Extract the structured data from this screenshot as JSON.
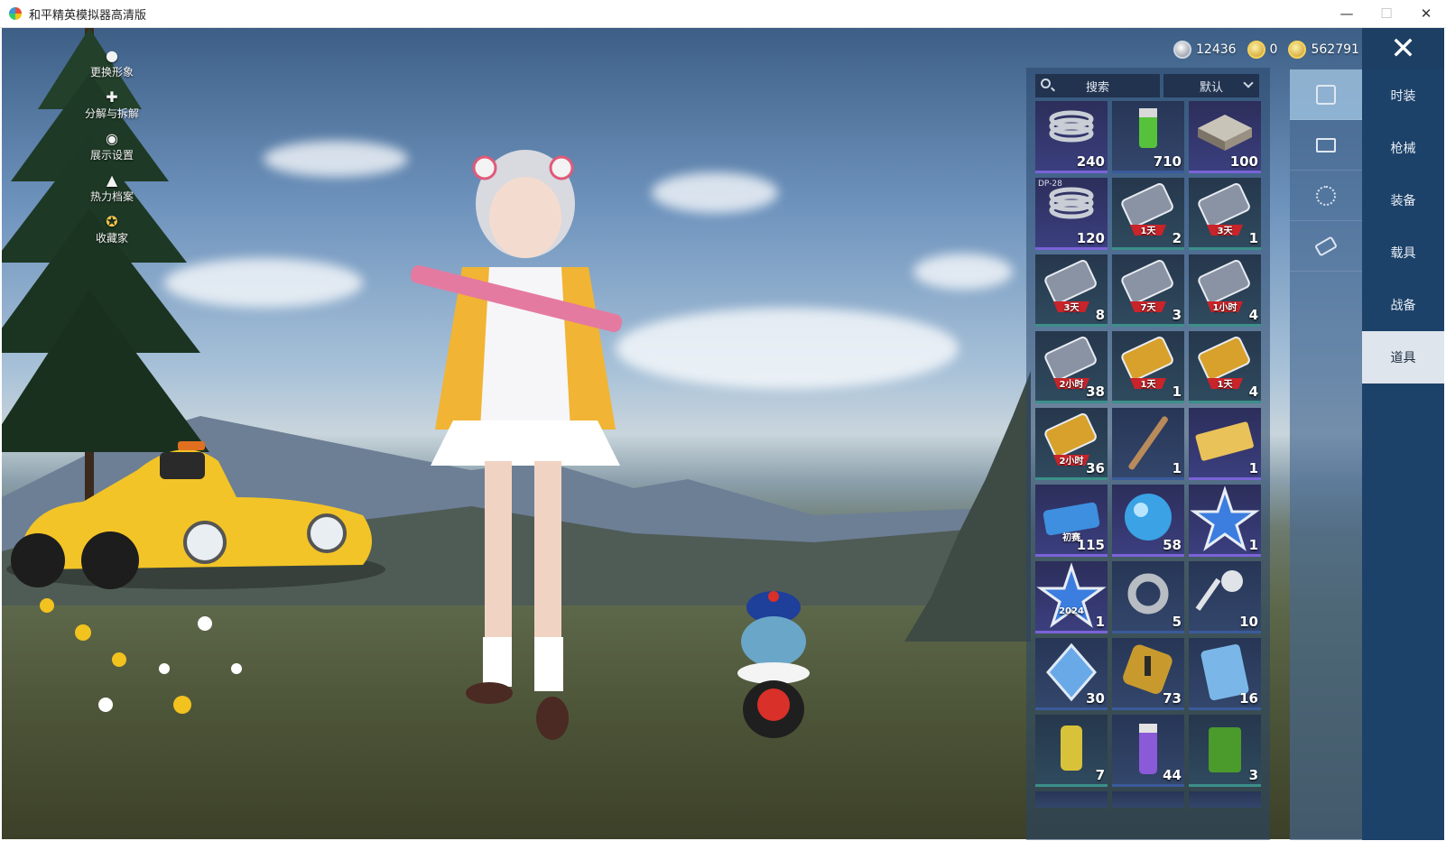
{
  "window": {
    "title": "和平精英模拟器高清版",
    "minimize": "—",
    "maximize": "☐",
    "close": "✕"
  },
  "left_menu": [
    {
      "label": "更换形象",
      "icon": "person-icon"
    },
    {
      "label": "分解与拆解",
      "icon": "puzzle-icon"
    },
    {
      "label": "展示设置",
      "icon": "eye-icon"
    },
    {
      "label": "热力档案",
      "icon": "flame-icon"
    },
    {
      "label": "收藏家",
      "icon": "collector-badge-icon"
    }
  ],
  "currency": [
    {
      "value": "12436",
      "icon": "silver-coin-icon"
    },
    {
      "value": "0",
      "icon": "gold-token-icon"
    },
    {
      "value": "562791",
      "icon": "gold-coin-icon"
    }
  ],
  "inventory": {
    "search_placeholder": "搜索",
    "sort_label": "默认",
    "items": [
      {
        "qty": "240",
        "icon": "spring-icon",
        "rarity": "purple"
      },
      {
        "qty": "710",
        "icon": "spray-can-icon",
        "rarity": "blue"
      },
      {
        "qty": "100",
        "icon": "ammo-box-icon",
        "rarity": "purple"
      },
      {
        "qty": "120",
        "icon": "spring-icon",
        "rarity": "purple",
        "tag": "DP-28"
      },
      {
        "qty": "2",
        "icon": "exp-card-icon",
        "rarity": "teal",
        "badge": "1天"
      },
      {
        "qty": "1",
        "icon": "exp-card-icon",
        "rarity": "teal",
        "badge": "3天"
      },
      {
        "qty": "8",
        "icon": "exp-card-icon",
        "rarity": "teal",
        "badge": "3天"
      },
      {
        "qty": "3",
        "icon": "exp-card-icon",
        "rarity": "teal",
        "badge": "7天"
      },
      {
        "qty": "4",
        "icon": "exp-card-icon",
        "rarity": "teal",
        "badge": "1小时"
      },
      {
        "qty": "38",
        "icon": "exp-card-icon",
        "rarity": "teal",
        "badge": "2小时"
      },
      {
        "qty": "1",
        "icon": "gold-exp-card-icon",
        "rarity": "teal",
        "badge": "1天"
      },
      {
        "qty": "4",
        "icon": "gold-exp-card-icon",
        "rarity": "teal",
        "badge": "1天"
      },
      {
        "qty": "36",
        "icon": "gold-exp-card-icon",
        "rarity": "teal",
        "badge": "2小时"
      },
      {
        "qty": "1",
        "icon": "baton-icon",
        "rarity": "blue"
      },
      {
        "qty": "1",
        "icon": "ticket-icon",
        "rarity": "purple"
      },
      {
        "qty": "115",
        "icon": "first-match-ticket-icon",
        "rarity": "purple",
        "badge": "初赛"
      },
      {
        "qty": "58",
        "icon": "blue-orb-icon",
        "rarity": "purple"
      },
      {
        "qty": "1",
        "icon": "star-badge-icon",
        "rarity": "purple"
      },
      {
        "qty": "1",
        "icon": "star-2024-icon",
        "rarity": "purple",
        "badge": "2024"
      },
      {
        "qty": "5",
        "icon": "ring-icon",
        "rarity": "blue"
      },
      {
        "qty": "10",
        "icon": "key-icon",
        "rarity": "blue"
      },
      {
        "qty": "30",
        "icon": "diamond-icon",
        "rarity": "blue"
      },
      {
        "qty": "73",
        "icon": "gold-emblem-icon",
        "rarity": "blue"
      },
      {
        "qty": "16",
        "icon": "card-icon",
        "rarity": "blue"
      },
      {
        "qty": "7",
        "icon": "canister-icon",
        "rarity": "teal"
      },
      {
        "qty": "44",
        "icon": "spray-paint-icon",
        "rarity": "blue"
      },
      {
        "qty": "3",
        "icon": "jerrycan-icon",
        "rarity": "teal"
      }
    ]
  },
  "categories": [
    {
      "icon": "outfit-card-icon",
      "active": true
    },
    {
      "icon": "chest-icon",
      "active": false
    },
    {
      "icon": "firework-icon",
      "active": false
    },
    {
      "icon": "coupon-icon",
      "active": false
    }
  ],
  "tabs": [
    {
      "label": "时装",
      "active": false
    },
    {
      "label": "枪械",
      "active": false
    },
    {
      "label": "装备",
      "active": false
    },
    {
      "label": "载具",
      "active": false
    },
    {
      "label": "战备",
      "active": false
    },
    {
      "label": "道具",
      "active": true
    }
  ],
  "colors": {
    "tab_bar": "#1d4269",
    "active_tab": "#dfe5ec",
    "rarity_purple": "#7a63d8",
    "rarity_blue": "#3a5a9a",
    "rarity_teal": "#3c8f8a"
  }
}
